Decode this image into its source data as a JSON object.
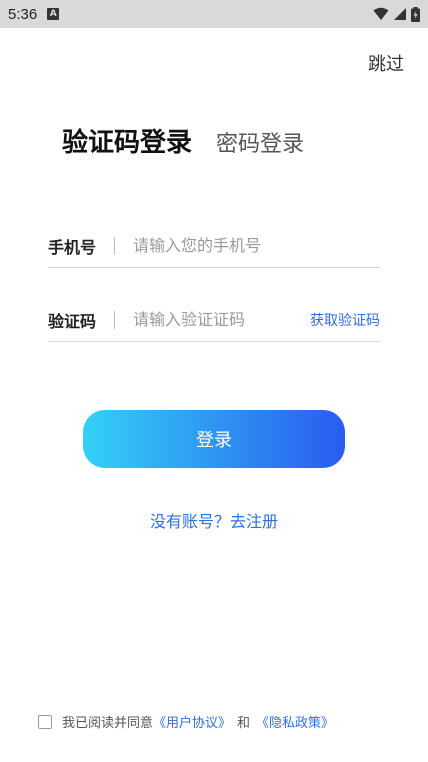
{
  "status_bar": {
    "time": "5:36",
    "notification_glyph": "A",
    "icons": [
      "wifi-icon",
      "signal-icon",
      "battery-charging-icon"
    ]
  },
  "header": {
    "skip_label": "跳过"
  },
  "tabs": [
    {
      "label": "验证码登录",
      "active": true
    },
    {
      "label": "密码登录",
      "active": false
    }
  ],
  "form": {
    "phone": {
      "label": "手机号",
      "placeholder": "请输入您的手机号",
      "value": ""
    },
    "code": {
      "label": "验证码",
      "placeholder": "请输入验证证码",
      "value": "",
      "get_code_label": "获取验证码"
    }
  },
  "login_button": {
    "label": "登录"
  },
  "register_link": {
    "label": "没有账号？去注册"
  },
  "agreement": {
    "prefix": "我已阅读并同意",
    "user_agreement": "《用户协议》",
    "and": "和",
    "privacy_policy": "《隐私政策》",
    "checked": false
  },
  "colors": {
    "accent": "#2f6fe0",
    "gradient_start": "#33d1f6",
    "gradient_end": "#2a5bf0",
    "status_bar_bg": "#d9d9d9"
  }
}
